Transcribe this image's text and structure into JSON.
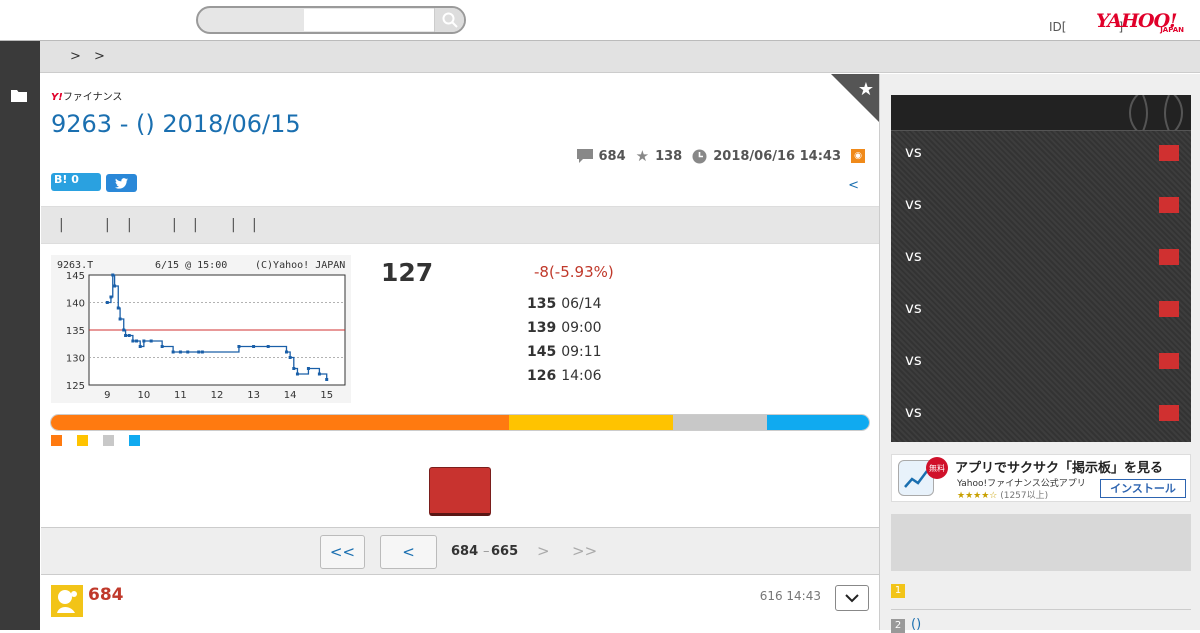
{
  "header": {
    "id_link": "ID[",
    "id_link_tail": "]",
    "logo_text": "YAHOO!",
    "logo_sub": "JAPAN",
    "search_placeholder": ""
  },
  "breadcrumb": {
    "sep1": ">",
    "sep2": ">"
  },
  "main": {
    "service_logo_y": "Y!",
    "service_logo": "ファイナンス",
    "title": "9263 - () 2018/06/15",
    "stats": {
      "comments": "684",
      "favorites": "138",
      "updated": "2018/06/16 14:43"
    },
    "hatena_label": "B!",
    "hatena_count": "0",
    "prev_link": "<",
    "tabs": [
      "|",
      "|",
      "|",
      "|",
      "|",
      "|",
      "|"
    ]
  },
  "quote": {
    "price": "127",
    "change": "-8(-5.93%)",
    "rows": [
      {
        "value": "135",
        "time": "06/14"
      },
      {
        "value": "139",
        "time": "09:00"
      },
      {
        "value": "145",
        "time": "09:11"
      },
      {
        "value": "126",
        "time": "14:06"
      }
    ]
  },
  "chart_data": {
    "type": "line",
    "title": "9263.T",
    "subtitle": "6/15 @ 15:00",
    "credit": "(C)Yahoo! JAPAN",
    "ylim": [
      125,
      145
    ],
    "yticks": [
      125,
      130,
      135,
      140,
      145
    ],
    "xlim": [
      8.5,
      15.5
    ],
    "xticks": [
      9,
      10,
      11,
      12,
      13,
      14,
      15
    ],
    "reference_line": 135,
    "series": [
      {
        "x": [
          9.0,
          9.1,
          9.15,
          9.2,
          9.3,
          9.35,
          9.45,
          9.5,
          9.6,
          9.7,
          9.8,
          9.9,
          10.0,
          10.2,
          10.5,
          10.8,
          11.0,
          11.2,
          11.5,
          11.6,
          12.6,
          13.0,
          13.4,
          13.9,
          14.0,
          14.1,
          14.2,
          14.5,
          14.8,
          15.0
        ],
        "values": [
          140,
          141,
          145,
          143,
          139,
          137,
          135,
          134,
          134,
          133,
          133,
          132,
          133,
          133,
          132,
          131,
          131,
          131,
          131,
          131,
          132,
          132,
          132,
          131,
          130,
          128,
          127,
          128,
          127,
          126
        ]
      }
    ],
    "colors": {
      "line": "#1a5fa8",
      "reference": "#d03030",
      "grid": "#999999"
    }
  },
  "sentiment": {
    "segments": [
      {
        "color": "#ff7a10",
        "share": 0.56
      },
      {
        "color": "#ffc300",
        "share": 0.2
      },
      {
        "color": "#c8c8c8",
        "share": 0.115
      },
      {
        "color": "#10aaf0",
        "share": 0.125
      }
    ]
  },
  "pager": {
    "first": "<<",
    "prev": "<",
    "from": "684",
    "dash": "–",
    "to": "665",
    "next": ">",
    "last": ">>"
  },
  "post": {
    "number": "684",
    "time": "616 14:43"
  },
  "sidebar": {
    "vs_rows": [
      "vs",
      "vs",
      "vs",
      "vs",
      "vs",
      "vs"
    ],
    "ad": {
      "badge": "無料",
      "title": "アプリでサクサク「掲示板」を見る",
      "subtitle": "Yahoo!ファイナンス公式アプリ",
      "stars": "★★★★☆",
      "reviews": "(1257以上)",
      "button": "インストール"
    },
    "ranking": [
      {
        "rank": "1",
        "label": ""
      },
      {
        "rank": "2",
        "label": "()"
      }
    ]
  }
}
